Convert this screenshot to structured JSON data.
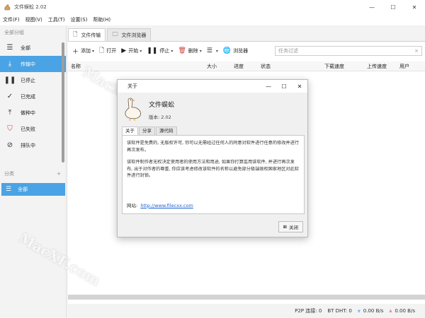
{
  "window": {
    "title": "文件蜈蚣 2.02",
    "min": "—",
    "max": "☐",
    "close": "✕"
  },
  "menu": [
    "文件(F)",
    "视图(V)",
    "工具(T)",
    "设置(S)",
    "帮助(H)"
  ],
  "sidebar": {
    "header": "全部分组",
    "items": [
      {
        "label": "全部",
        "icon": "menu-icon"
      },
      {
        "label": "传输中",
        "icon": "download-icon"
      },
      {
        "label": "已停止",
        "icon": "pause-icon"
      },
      {
        "label": "已完成",
        "icon": "check-icon"
      },
      {
        "label": "做种中",
        "icon": "upload-icon"
      },
      {
        "label": "已失败",
        "icon": "error-icon"
      },
      {
        "label": "排队中",
        "icon": "queue-icon"
      }
    ],
    "active_index": 1,
    "category_header": "分类",
    "category_add": "+",
    "category_item": "全部"
  },
  "tabs": [
    {
      "label": "文件传输",
      "icon": "file-icon"
    },
    {
      "label": "文件浏览器",
      "icon": "folder-icon"
    }
  ],
  "toolbar": {
    "add": "添加",
    "open": "打开",
    "start": "开始",
    "stop": "停止",
    "delete": "删除",
    "browser": "浏览器",
    "filter_placeholder": "任务过滤",
    "filter_clear": "×"
  },
  "columns": [
    "名称",
    "大小",
    "进度",
    "状态",
    "下载速度",
    "上传速度",
    "用户"
  ],
  "status": {
    "p2p_label": "P2P 连接:",
    "p2p_value": "0",
    "dht_label": "BT DHT:",
    "dht_value": "0",
    "down_speed": "0.00 B/s",
    "up_speed": "0.00 B/s"
  },
  "dialog": {
    "title": "关于",
    "app_name": "文件蜈蚣",
    "version": "版本: 2.02",
    "tabs": [
      "关于",
      "分享",
      "源代码"
    ],
    "para1": "该软件是免费的, 无版权许可, 你可以无需经过任何人的同意对软件进行任意的修改并进行再次发布。",
    "para2": "该软件制作者无权决定使用者的使用方法和用途, 如果你打算滥用该软件, 并进行再次发布, 出于对作者的尊重, 你应该考虑修改该软件的名称以避免部分极端政权国家地区对此软件进行封锁。",
    "site_label": "网站:",
    "site_url": "http://www.filecxx.com",
    "close_label": "关闭"
  },
  "watermark": "MacXF.com",
  "colors": {
    "accent": "#4aa3e4",
    "link": "#1a5fd0"
  }
}
